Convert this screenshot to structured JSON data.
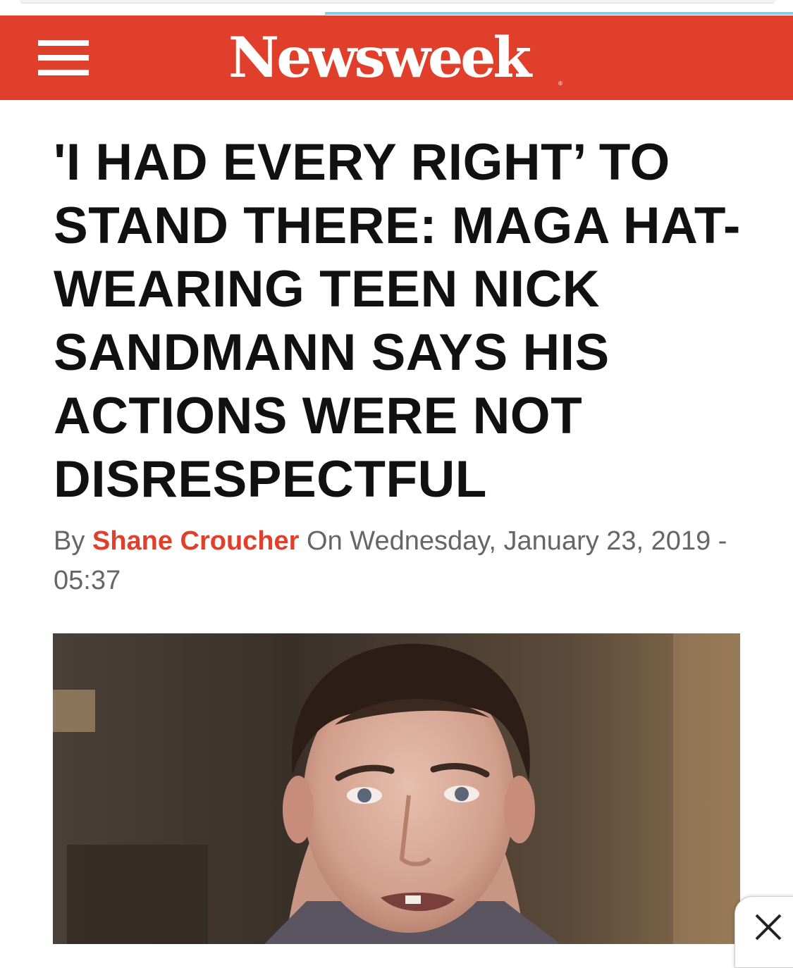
{
  "browser": {
    "load_progress": 0.59
  },
  "header": {
    "logo_text": "Newsweek",
    "logo_trademark": "®",
    "brand_color": "#e0402b",
    "menu_icon": "hamburger-menu-icon"
  },
  "article": {
    "headline": "'I HAD EVERY RIGHT’ TO STAND THERE: MAGA HAT-WEARING TEEN NICK SANDMANN SAYS HIS ACTIONS WERE NOT DISRESPECTFUL",
    "byline": {
      "prefix": "By",
      "author": "Shane Croucher",
      "date": "On Wednesday, January 23, 2019 - 05:37"
    }
  },
  "ad": {
    "close_icon": "close-icon"
  }
}
